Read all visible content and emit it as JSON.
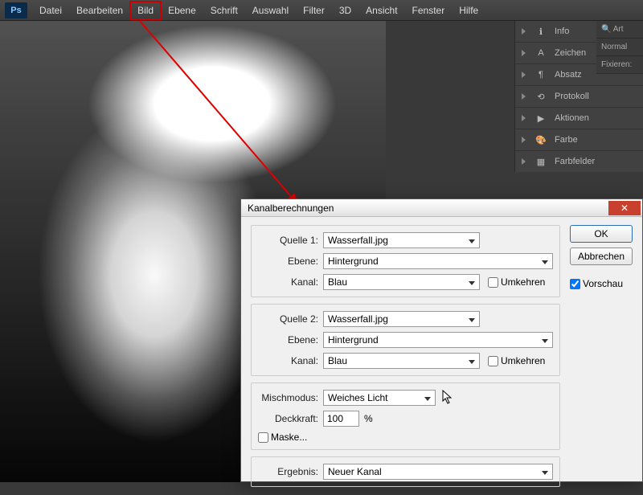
{
  "menu": [
    "Datei",
    "Bearbeiten",
    "Bild",
    "Ebene",
    "Schrift",
    "Auswahl",
    "Filter",
    "3D",
    "Ansicht",
    "Fenster",
    "Hilfe"
  ],
  "menu_highlight_index": 2,
  "panels": [
    {
      "icon": "info-icon",
      "label": "Info"
    },
    {
      "icon": "type-icon",
      "label": "Zeichen"
    },
    {
      "icon": "paragraph-icon",
      "label": "Absatz"
    },
    {
      "icon": "history-icon",
      "label": "Protokoll"
    },
    {
      "icon": "play-icon",
      "label": "Aktionen"
    },
    {
      "icon": "palette-icon",
      "label": "Farbe"
    },
    {
      "icon": "swatches-icon",
      "label": "Farbfelder"
    }
  ],
  "right_opts": {
    "search_placeholder": "Art",
    "blend_mode": "Normal",
    "lock_label": "Fixieren:"
  },
  "dialog": {
    "title": "Kanalberechnungen",
    "source1": {
      "label": "Quelle 1:",
      "file": "Wasserfall.jpg",
      "layer_label": "Ebene:",
      "layer": "Hintergrund",
      "channel_label": "Kanal:",
      "channel": "Blau",
      "invert_label": "Umkehren",
      "invert": false
    },
    "source2": {
      "label": "Quelle 2:",
      "file": "Wasserfall.jpg",
      "layer_label": "Ebene:",
      "layer": "Hintergrund",
      "channel_label": "Kanal:",
      "channel": "Blau",
      "invert_label": "Umkehren",
      "invert": false
    },
    "blend": {
      "label": "Mischmodus:",
      "value": "Weiches Licht",
      "opacity_label": "Deckkraft:",
      "opacity": "100",
      "opacity_suffix": "%",
      "mask_label": "Maske...",
      "mask": false
    },
    "result": {
      "label": "Ergebnis:",
      "value": "Neuer Kanal"
    },
    "buttons": {
      "ok": "OK",
      "cancel": "Abbrechen"
    },
    "preview": {
      "label": "Vorschau",
      "checked": true
    }
  }
}
